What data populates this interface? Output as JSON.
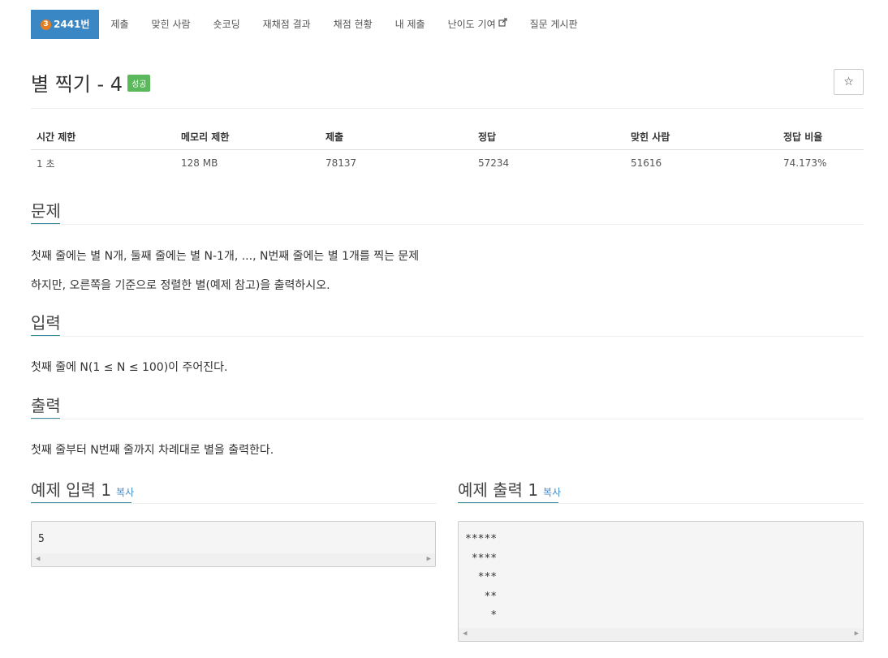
{
  "tabs": [
    {
      "label": "2441번",
      "tier": "3",
      "active": true
    },
    {
      "label": "제출"
    },
    {
      "label": "맞힌 사람"
    },
    {
      "label": "숏코딩"
    },
    {
      "label": "재채점 결과"
    },
    {
      "label": "채점 현황"
    },
    {
      "label": "내 제출"
    },
    {
      "label": "난이도 기여",
      "icon": "external-link-icon"
    },
    {
      "label": "질문 게시판"
    }
  ],
  "title": {
    "text": "별 찍기 - 4",
    "badge": "성공",
    "star": "☆"
  },
  "info": {
    "headers": [
      "시간 제한",
      "메모리 제한",
      "제출",
      "정답",
      "맞힌 사람",
      "정답 비율"
    ],
    "values": [
      "1 초",
      "128 MB",
      "78137",
      "57234",
      "51616",
      "74.173%"
    ]
  },
  "problem": {
    "heading": "문제",
    "lines": [
      "첫째 줄에는 별 N개, 둘째 줄에는 별 N-1개, ..., N번째 줄에는 별 1개를 찍는 문제",
      "하지만, 오른쪽을 기준으로 정렬한 별(예제 참고)을 출력하시오."
    ]
  },
  "input": {
    "heading": "입력",
    "text": "첫째 줄에 N(1 ≤ N ≤ 100)이 주어진다."
  },
  "output": {
    "heading": "출력",
    "text": "첫째 줄부터 N번째 줄까지 차례대로 별을 출력한다."
  },
  "sample_input": {
    "heading": "예제 입력 1",
    "copy": "복사",
    "content": "5"
  },
  "sample_output": {
    "heading": "예제 출력 1",
    "copy": "복사",
    "content": "*****\n ****\n  ***\n   **\n    *"
  },
  "colors": {
    "tab_active": "#3a87c6",
    "badge_success": "#5cb85c",
    "link": "#428bca",
    "tier": "#e67e22"
  }
}
